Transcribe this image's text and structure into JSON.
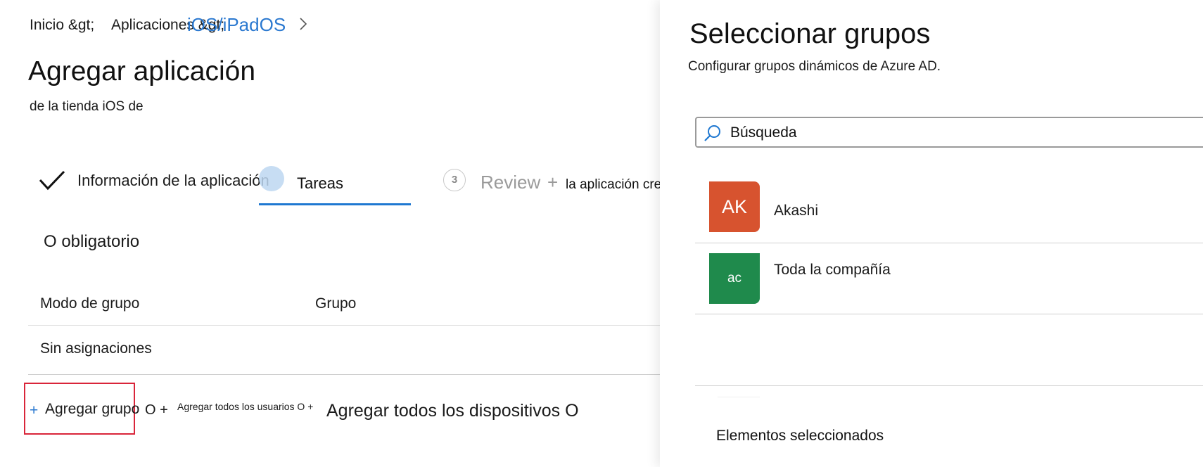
{
  "breadcrumb": {
    "home": "Inicio &gt;",
    "apps": "Aplicaciones &gt;",
    "platform": "iOS/iPadOS"
  },
  "page": {
    "title": "Agregar aplicación",
    "subtitle": "de la tienda iOS de"
  },
  "wizard": {
    "step1_label": "Información de la aplicación",
    "step2_label": "Tareas",
    "step3_number": "3",
    "step3_label": "Review",
    "step3_plus": "+",
    "step3_extra": "la aplicación crear"
  },
  "assignments": {
    "section_title": "O obligatorio",
    "columns": [
      "Modo de grupo",
      "Grupo"
    ],
    "empty_text": "Sin asignaciones",
    "add_plus": "+",
    "add_group": "Agregar grupo",
    "add_group_suffix": "O +",
    "add_users": "Agregar todos los usuarios O +",
    "add_devices": "Agregar todos los dispositivos O"
  },
  "panel": {
    "title": "Seleccionar grupos",
    "subtitle": "Configurar grupos dinámicos de Azure AD.",
    "search_placeholder": "Búsqueda",
    "groups": [
      {
        "initials": "AK",
        "name": "Akashi",
        "color": "#d7532f"
      },
      {
        "initials": "ac",
        "name": "Toda la compañía",
        "color": "#1f8a4c"
      }
    ],
    "selected_title": "Elementos seleccionados"
  },
  "colors": {
    "accent": "#1f78d1",
    "link": "#2b79d0",
    "highlight": "#d9253a"
  }
}
